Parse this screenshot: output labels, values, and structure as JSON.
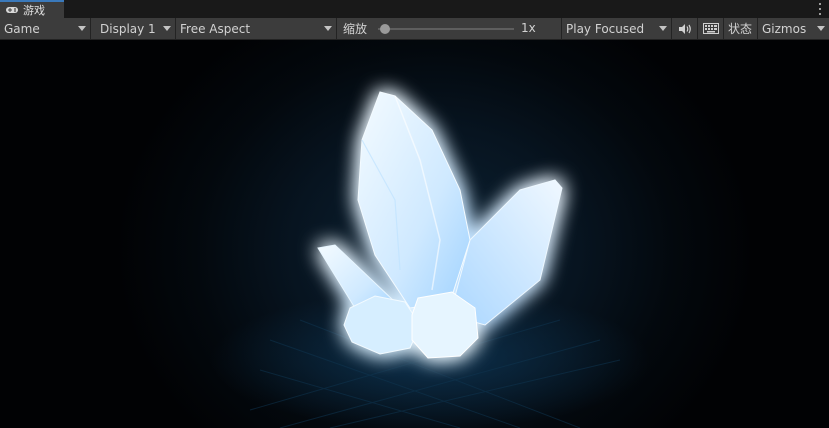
{
  "tab": {
    "title": "游戏",
    "icon": "gamepad-icon"
  },
  "menu_icon": "kebab-menu-icon",
  "toolbar": {
    "view_mode": "Game",
    "display": "Display 1",
    "aspect": "Free Aspect",
    "scale_label": "缩放",
    "scale_value": "1x",
    "scale_fraction": 0.05,
    "play_mode": "Play Focused",
    "audio_icon": "speaker-icon",
    "keyboard_icon": "keyboard-icon",
    "stats_label": "状态",
    "gizmos_label": "Gizmos"
  },
  "colors": {
    "accent": "#3a79bb",
    "toolbar_bg": "#3c3c3c",
    "crystal_glow": "#1e8fff"
  }
}
